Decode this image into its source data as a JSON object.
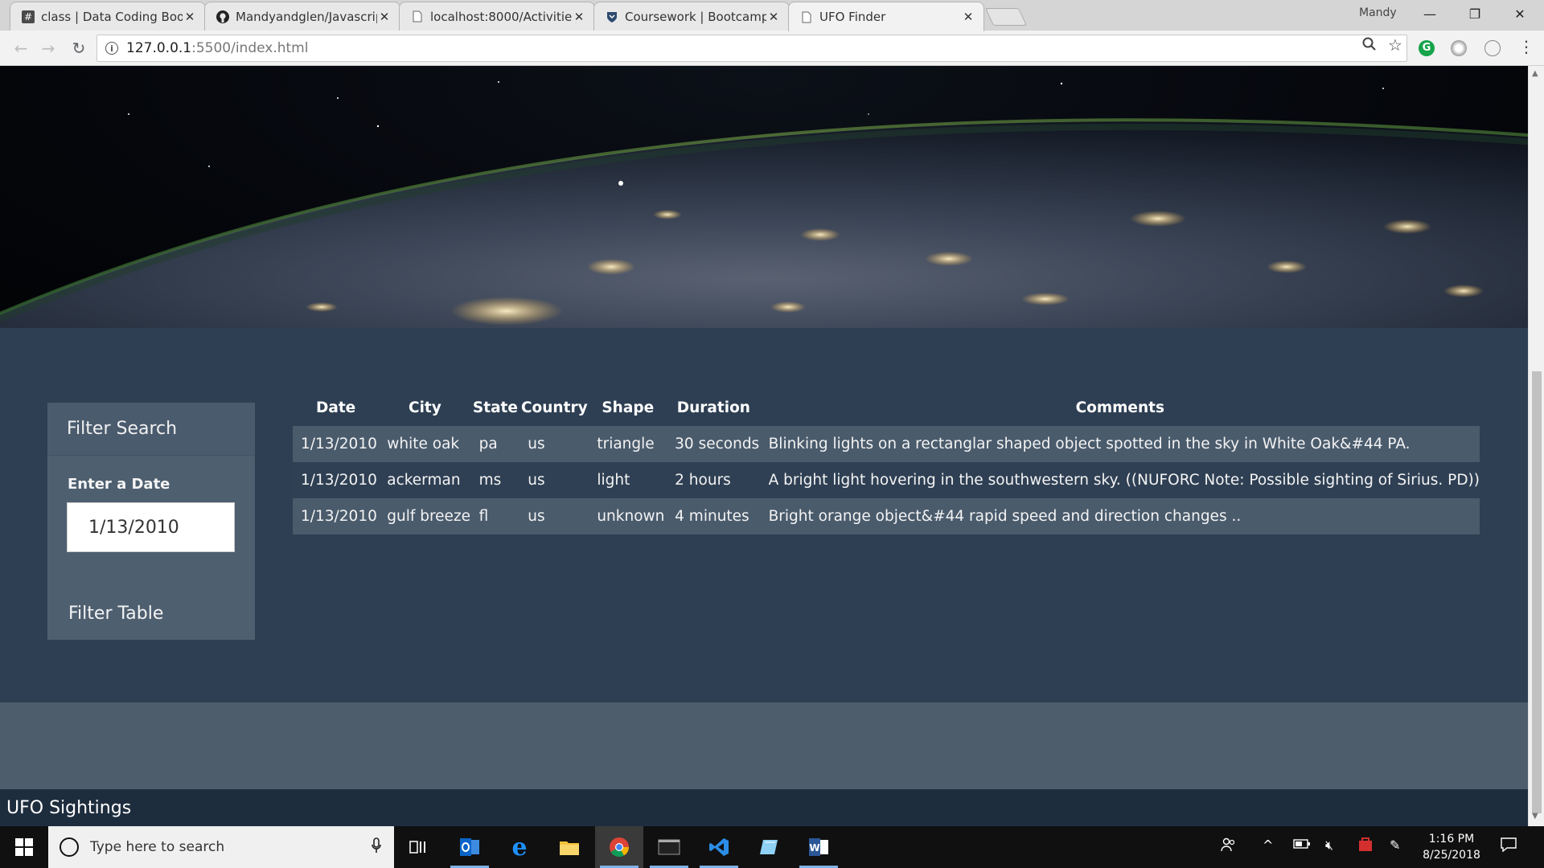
{
  "browser": {
    "tabs": [
      {
        "title": "class | Data Coding Boot",
        "icon": "slack-hash-icon"
      },
      {
        "title": "Mandyandglen/Javascrip",
        "icon": "github-icon"
      },
      {
        "title": "localhost:8000/Activities/",
        "icon": "page-icon"
      },
      {
        "title": "Coursework | Bootcamp S",
        "icon": "bootcamp-shield-icon"
      },
      {
        "title": "UFO Finder",
        "icon": "page-icon"
      }
    ],
    "profile_name": "Mandy",
    "url_host": "127.0.0.1",
    "url_rest": ":5500/index.html"
  },
  "filter": {
    "heading": "Filter Search",
    "date_label": "Enter a Date",
    "date_value": "1/13/2010",
    "button_label": "Filter Table"
  },
  "table": {
    "columns": [
      "Date",
      "City",
      "State",
      "Country",
      "Shape",
      "Duration",
      "Comments"
    ],
    "rows": [
      [
        "1/13/2010",
        "white oak",
        "pa",
        "us",
        "triangle",
        "30 seconds",
        "Blinking lights on a rectanglar shaped object spotted in the sky in White Oak&#44 PA."
      ],
      [
        "1/13/2010",
        "ackerman",
        "ms",
        "us",
        "light",
        "2 hours",
        "A bright light hovering in the southwestern sky. ((NUFORC Note: Possible sighting of Sirius. PD))"
      ],
      [
        "1/13/2010",
        "gulf breeze",
        "fl",
        "us",
        "unknown",
        "4 minutes",
        "Bright orange object&#44 rapid speed and direction changes .."
      ]
    ]
  },
  "footer": {
    "title": "UFO Sightings"
  },
  "taskbar": {
    "search_placeholder": "Type here to search",
    "time": "1:16 PM",
    "date": "8/25/2018"
  }
}
